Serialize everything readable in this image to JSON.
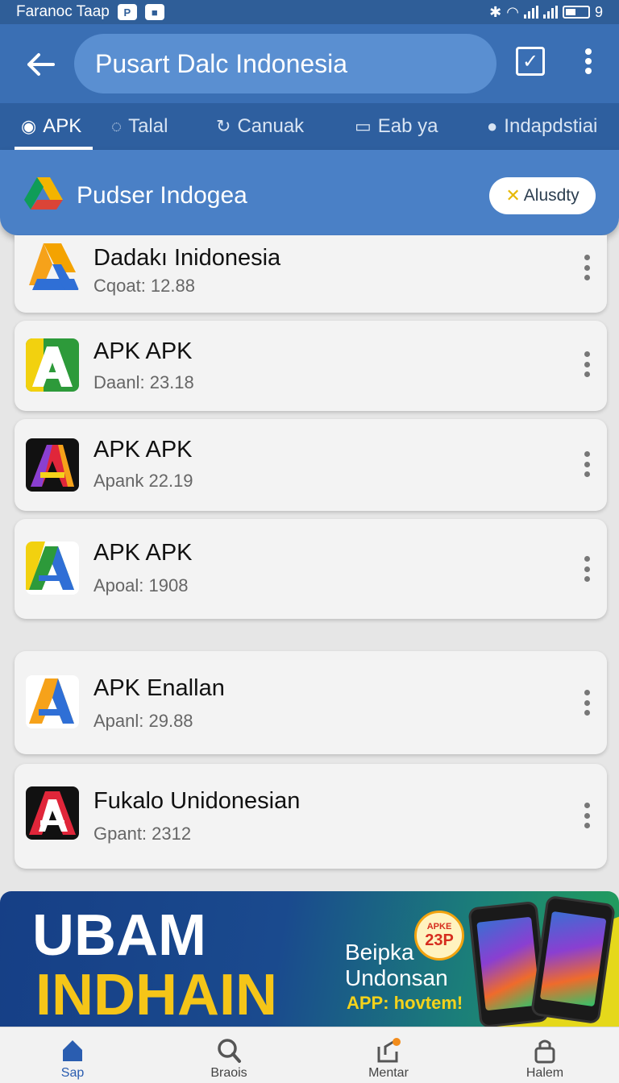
{
  "status_bar": {
    "left_text": "Faranoc Taap",
    "badge1": "P",
    "right_text": "9"
  },
  "app_bar": {
    "search_text": "Pusart Dalc Indonesia"
  },
  "tabs": [
    {
      "label": "APK",
      "active": true
    },
    {
      "label": "Talal",
      "active": false
    },
    {
      "label": "Canuak",
      "active": false
    },
    {
      "label": "Eab ya",
      "active": false
    },
    {
      "label": "Indapdstiai",
      "active": false
    }
  ],
  "header": {
    "title": "Pudser Indogea",
    "action_label": "Alusdty"
  },
  "apps": [
    {
      "name": "Dadakı Inidonesia",
      "sub": "Cqoat: 12.88",
      "icon": "apk-logo-yellow-blue"
    },
    {
      "name": "APK APK",
      "sub": "Daanl: 23.18",
      "icon": "apk-logo-green"
    },
    {
      "name": "APK APK",
      "sub": "Apank 22.19",
      "icon": "apk-logo-rainbow-dark"
    },
    {
      "name": "APK APK",
      "sub": "Apoal: 1908",
      "icon": "apk-logo-green-blue"
    },
    {
      "name": "APK Enallan",
      "sub": "Apanl: 29.88",
      "icon": "apk-logo-orange-blue"
    },
    {
      "name": "Fukalo Unidonesian",
      "sub": "Gpant: 2312",
      "icon": "apk-logo-red-black"
    }
  ],
  "banner": {
    "line1": "UBAM",
    "line2": "INDHAIN",
    "badge_small": "APKE",
    "badge_big": "23P",
    "text1": "Beipka",
    "text2": "Undonsan",
    "text3": "APP: hovtem!"
  },
  "bottom_nav": [
    {
      "label": "Sap",
      "icon": "home-icon",
      "active": true
    },
    {
      "label": "Braois",
      "icon": "search-icon",
      "active": false
    },
    {
      "label": "Mentar",
      "icon": "share-icon",
      "active": false
    },
    {
      "label": "Halem",
      "icon": "lock-icon",
      "active": false
    }
  ],
  "colors": {
    "primary": "#3a6fb4",
    "tab_bar": "#2e5f9f",
    "accent_yellow": "#f5c518"
  }
}
